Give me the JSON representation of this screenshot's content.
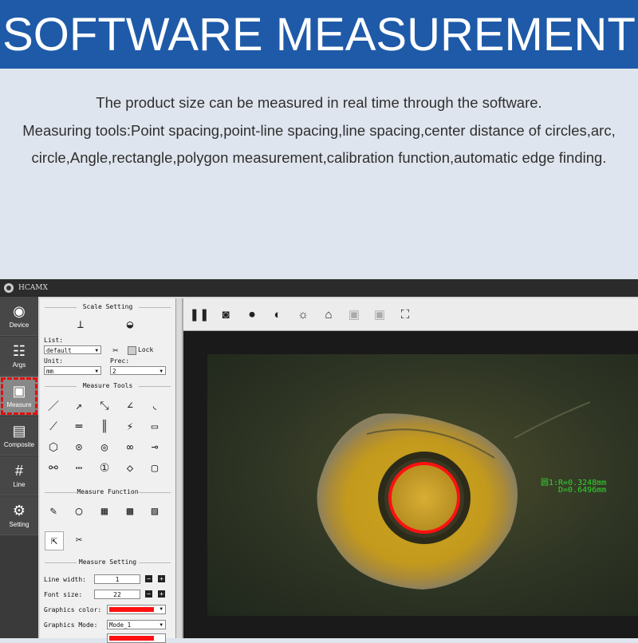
{
  "banner": {
    "title": "SOFTWARE MEASUREMENT"
  },
  "description": {
    "line1": "The product size can be measured in real time through the software.",
    "line2": "Measuring tools:Point spacing,point-line spacing,line spacing,center distance of circles,arc,",
    "line3": "circle,Angle,rectangle,polygon measurement,calibration function,automatic edge finding."
  },
  "app": {
    "title": "HCAMX",
    "nav": [
      {
        "label": "Device",
        "icon": "webcam-icon"
      },
      {
        "label": "Args",
        "icon": "sliders-icon"
      },
      {
        "label": "Measure",
        "icon": "measure-icon"
      },
      {
        "label": "Composite",
        "icon": "composite-icon"
      },
      {
        "label": "Line",
        "icon": "grid-icon"
      },
      {
        "label": "Setting",
        "icon": "gear-icon"
      }
    ],
    "scale_setting": {
      "title": "Scale Setting",
      "list_label": "List:",
      "list_value": "default",
      "lock_label": "Lock",
      "unit_label": "Unit:",
      "unit_value": "mm",
      "prec_label": "Prec:",
      "prec_value": "2"
    },
    "measure_tools": {
      "title": "Measure Tools"
    },
    "measure_function": {
      "title": "Measure Function"
    },
    "measure_setting": {
      "title": "Measure Setting",
      "line_width_label": "Line width:",
      "line_width_value": "1",
      "font_size_label": "Font size:",
      "font_size_value": "22",
      "graphics_color_label": "Graphics color:",
      "graphics_color": "#ff1010",
      "graphics_mode_label": "Graphics Mode:",
      "graphics_mode_value": "Mode_1"
    },
    "readout": {
      "line1": "圆1:R=0.3248mm",
      "line2": "D=0.6496mm"
    }
  }
}
